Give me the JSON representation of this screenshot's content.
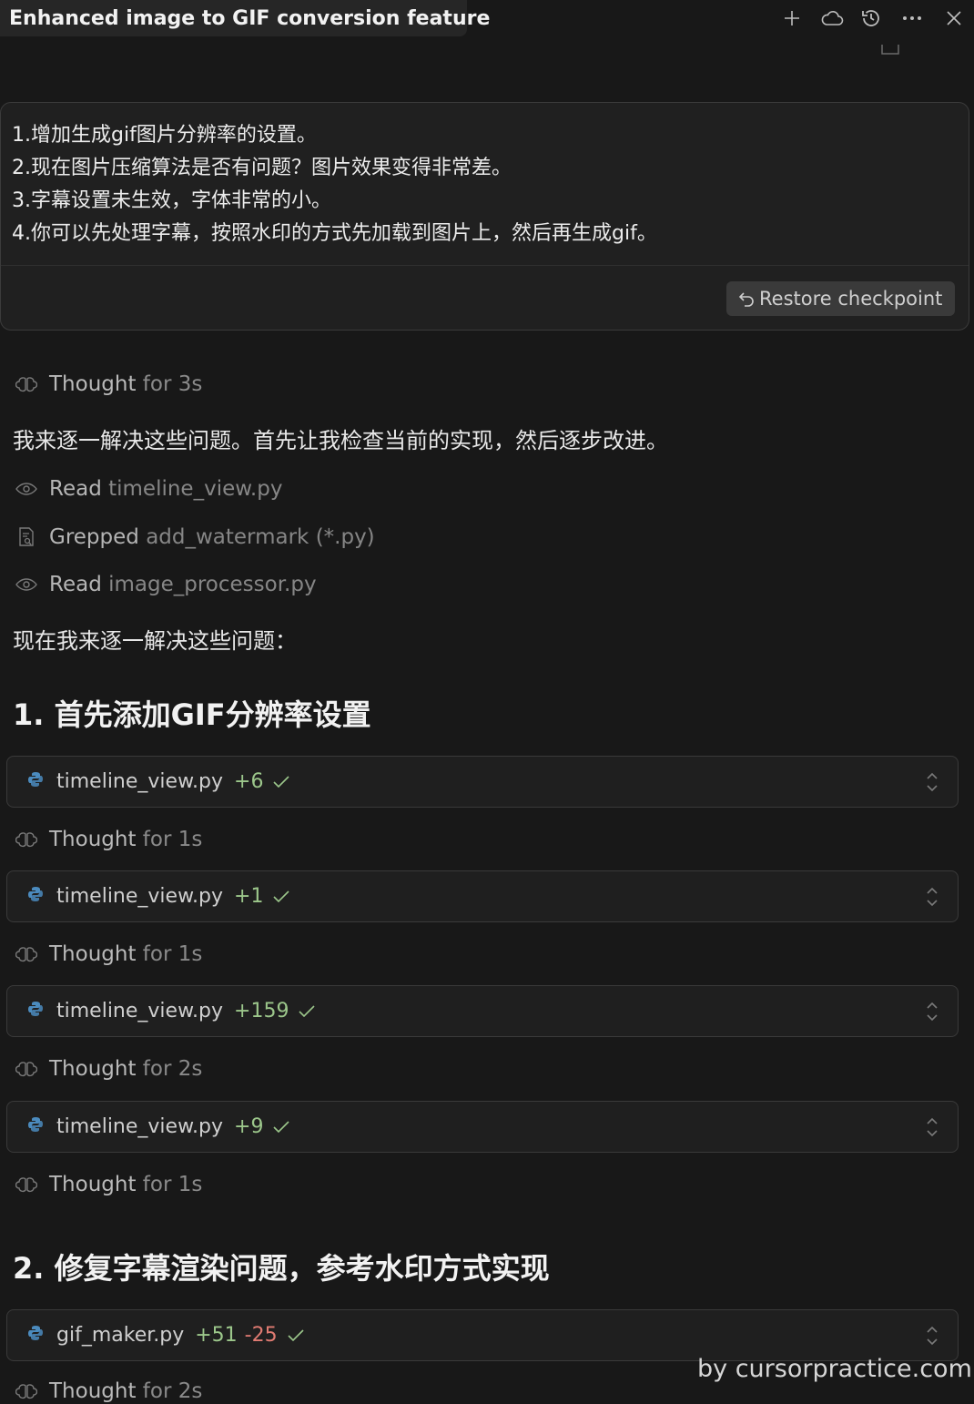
{
  "window": {
    "tab_title": "Enhanced image to GIF conversion feature",
    "actions": [
      {
        "icon": "plus-icon",
        "name": "new-chat"
      },
      {
        "icon": "cloud-icon",
        "name": "cloud"
      },
      {
        "icon": "history-icon",
        "name": "history"
      },
      {
        "icon": "more-icon",
        "name": "more"
      },
      {
        "icon": "close-icon",
        "name": "close"
      }
    ]
  },
  "user_message": {
    "lines": [
      "1.增加生成gif图片分辨率的设置。",
      "2.现在图片压缩算法是否有问题？图片效果变得非常差。",
      "3.字幕设置未生效，字体非常的小。",
      "4.你可以先处理字幕，按照水印的方式先加载到图片上，然后再生成gif。"
    ],
    "restore_label": "Restore checkpoint"
  },
  "conversation": {
    "thought1": {
      "label": "Thought",
      "duration": "for 3s"
    },
    "intro": "我来逐一解决这些问题。首先让我检查当前的实现，然后逐步改进。",
    "tools": [
      {
        "icon": "eye-icon",
        "action": "Read",
        "target": "timeline_view.py"
      },
      {
        "icon": "grep-icon",
        "action": "Grepped",
        "target": "add_watermark (*.py)"
      },
      {
        "icon": "eye-icon",
        "action": "Read",
        "target": "image_processor.py"
      }
    ],
    "intro2": "现在我来逐一解决这些问题：",
    "heading1": "1. 首先添加GIF分辨率设置",
    "edit1": {
      "file": "timeline_view.py",
      "added": "+6"
    },
    "thought2": {
      "label": "Thought",
      "duration": "for 1s"
    },
    "edit2": {
      "file": "timeline_view.py",
      "added": "+1"
    },
    "thought3": {
      "label": "Thought",
      "duration": "for 1s"
    },
    "edit3": {
      "file": "timeline_view.py",
      "added": "+159"
    },
    "thought4": {
      "label": "Thought",
      "duration": "for 2s"
    },
    "edit4": {
      "file": "timeline_view.py",
      "added": "+9"
    },
    "thought5": {
      "label": "Thought",
      "duration": "for 1s"
    },
    "heading2": "2. 修复字幕渲染问题，参考水印方式实现",
    "edit5": {
      "file": "gif_maker.py",
      "added": "+51",
      "removed": "-25"
    },
    "thought6": {
      "label": "Thought",
      "duration": "for 2s"
    }
  },
  "watermark": "by cursorpractice.com",
  "colors": {
    "background": "#181818",
    "added": "#9cc78b",
    "removed": "#e07b72",
    "python_blue": "#4b8bbe",
    "python_yellow": "#ffd43b"
  }
}
